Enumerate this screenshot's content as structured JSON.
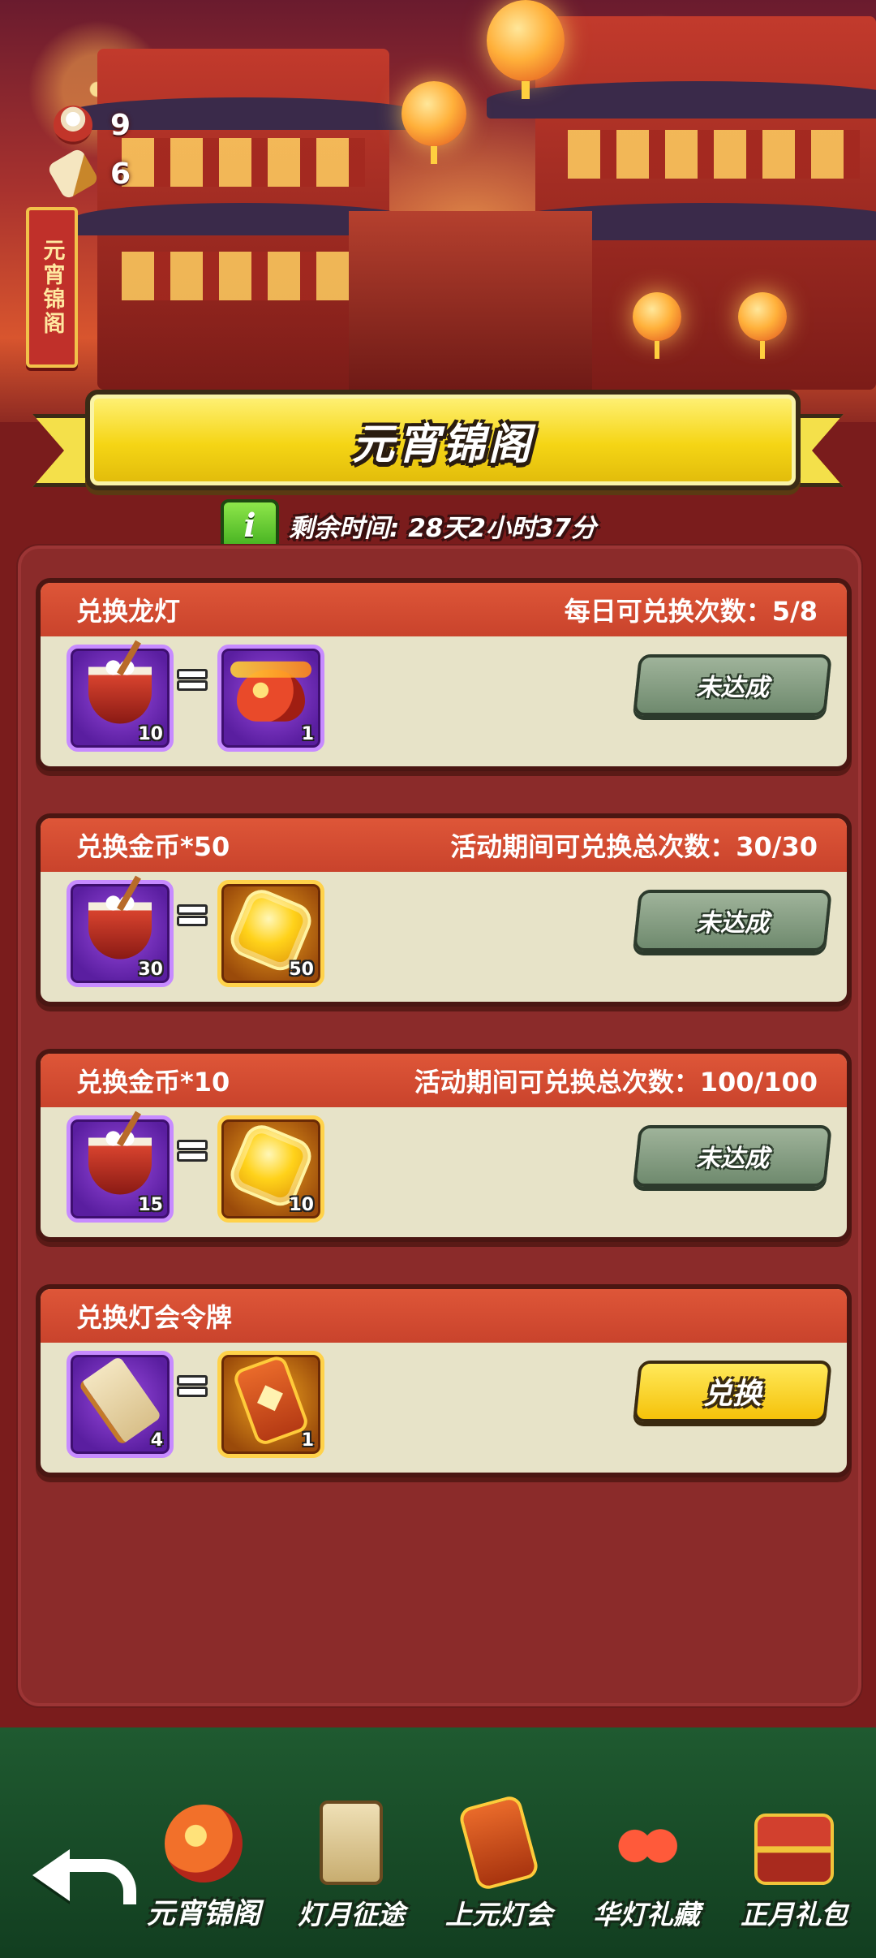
{
  "scene": {
    "banner_vertical": "元宵锦阁",
    "resources": [
      {
        "icon": "tangyuan-bowl-icon",
        "count": "9"
      },
      {
        "icon": "scroll-icon",
        "count": "6"
      }
    ]
  },
  "header": {
    "title": "元宵锦阁",
    "info_icon_letter": "i",
    "timer_text": "剩余时间: 28天2小时37分"
  },
  "exchanges": [
    {
      "title": "兑换龙灯",
      "limit": "每日可兑换次数：5/8",
      "cost": {
        "icon": "tangyuan-bowl-icon",
        "qty": "10",
        "frame": "purple"
      },
      "reward": {
        "icon": "dragon-lantern-icon",
        "qty": "1",
        "frame": "purple"
      },
      "button": "未达成",
      "enabled": false
    },
    {
      "title": "兑换金币*50",
      "limit": "活动期间可兑换总次数：30/30",
      "cost": {
        "icon": "tangyuan-bowl-icon",
        "qty": "30",
        "frame": "purple"
      },
      "reward": {
        "icon": "gold-coin-icon",
        "qty": "50",
        "frame": "gold"
      },
      "button": "未达成",
      "enabled": false
    },
    {
      "title": "兑换金币*10",
      "limit": "活动期间可兑换总次数：100/100",
      "cost": {
        "icon": "tangyuan-bowl-icon",
        "qty": "15",
        "frame": "purple"
      },
      "reward": {
        "icon": "gold-coin-icon",
        "qty": "10",
        "frame": "gold"
      },
      "button": "未达成",
      "enabled": false
    },
    {
      "title": "兑换灯会令牌",
      "limit": "",
      "cost": {
        "icon": "scroll-icon",
        "qty": "4",
        "frame": "purple"
      },
      "reward": {
        "icon": "festival-token-icon",
        "qty": "1",
        "frame": "gold"
      },
      "button": "兑换",
      "enabled": true
    }
  ],
  "bottom_nav": {
    "back_icon": "back-arrow-icon",
    "tabs": [
      {
        "label": "元宵锦阁",
        "icon": "dragon-icon",
        "selected": true
      },
      {
        "label": "灯月征途",
        "icon": "lantern-tag-icon",
        "selected": false
      },
      {
        "label": "上元灯会",
        "icon": "token-icon",
        "selected": false
      },
      {
        "label": "华灯礼藏",
        "icon": "red-lanterns-icon",
        "selected": false
      },
      {
        "label": "正月礼包",
        "icon": "treasure-chest-icon",
        "selected": false
      }
    ]
  },
  "colors": {
    "card_header": "#de5638",
    "card_body": "#e7e3c8",
    "panel": "#8b2b2a",
    "ribbon": "#f5d515",
    "bottom_bar": "#1f5a30"
  }
}
